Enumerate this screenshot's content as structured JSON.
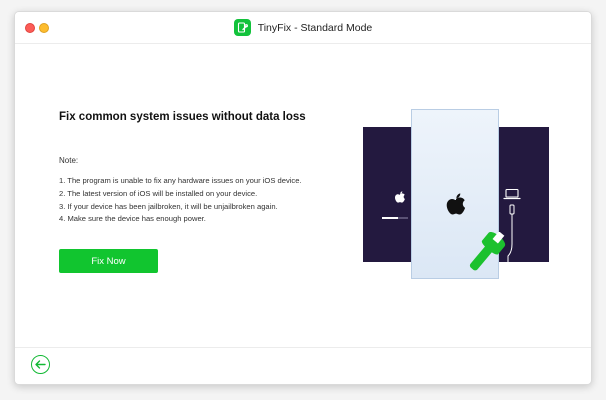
{
  "window": {
    "title": "TinyFix - Standard Mode"
  },
  "colors": {
    "accent": "#11c52f",
    "illustration_dark": "#23193f",
    "close": "#fc5c57",
    "minimize": "#fdbc2e"
  },
  "main": {
    "heading": "Fix common system issues without data loss",
    "note_label": "Note:",
    "notes": [
      "1. The program is unable to fix any hardware issues on your iOS device.",
      "2. The latest version of iOS will be installed on your device.",
      "3. If your device has been jailbroken, it will be unjailbroken again.",
      "4. Make sure the device has enough power."
    ],
    "fix_button_label": "Fix Now"
  },
  "icons": {
    "app_logo": "app-logo-icon",
    "back": "back-arrow-icon",
    "apple": "apple-logo-icon",
    "laptop": "laptop-icon",
    "wrench": "wrench-icon"
  },
  "illustration": {
    "progress_fraction": 0.6
  }
}
